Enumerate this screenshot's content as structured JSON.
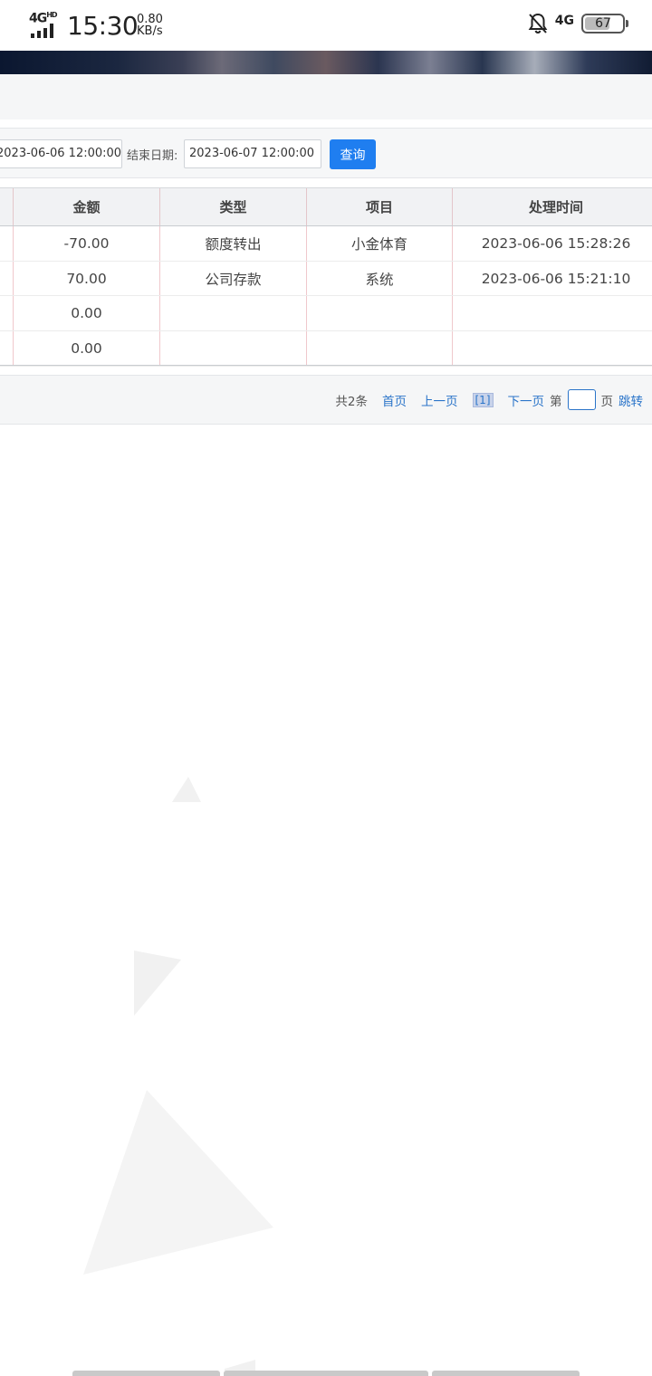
{
  "status_bar": {
    "network": "4G",
    "network_sup": "HD",
    "time": "15:30",
    "speed_value": "0.80",
    "speed_unit": "KB/s",
    "signal_type": "4G",
    "battery": "67"
  },
  "filter": {
    "start_date": "2023-06-06 12:00:00",
    "end_label": "结束日期:",
    "end_date": "2023-06-07 12:00:00",
    "query_label": "查询"
  },
  "table": {
    "columns": [
      "",
      "金额",
      "类型",
      "项目",
      "处理时间"
    ],
    "rows": [
      [
        "",
        "-70.00",
        "额度转出",
        "小金体育",
        "2023-06-06 15:28:26"
      ],
      [
        "",
        "70.00",
        "公司存款",
        "系统",
        "2023-06-06 15:21:10"
      ],
      [
        "",
        "0.00",
        "",
        "",
        ""
      ],
      [
        "",
        "0.00",
        "",
        "",
        ""
      ]
    ]
  },
  "pager": {
    "total": "共2条",
    "first": "首页",
    "prev": "上一页",
    "current": "[1]",
    "next": "下一页",
    "page_prefix": "第",
    "page_suffix": "页",
    "jump": "跳转"
  }
}
